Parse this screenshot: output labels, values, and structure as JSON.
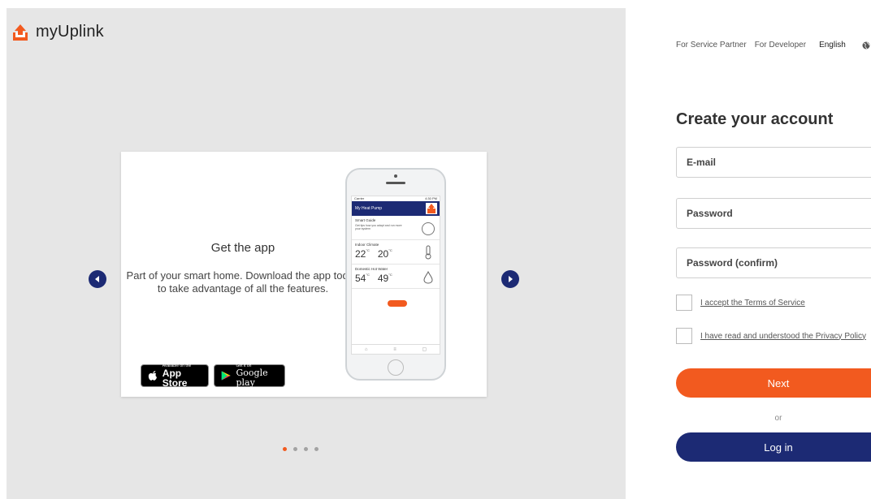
{
  "brand": {
    "name": "myUplink",
    "color": "#f25a1f",
    "navy": "#1c2a74"
  },
  "carousel": {
    "title": "Get the app",
    "body": "Part of your smart home. Download the app today to take advantage of all the features.",
    "app_store": {
      "small": "Available on the",
      "big": "App Store"
    },
    "google_play": {
      "small": "Get it on",
      "big": "Google play"
    },
    "dots": 4,
    "active_dot": 0,
    "phone": {
      "carrier": "Carrier",
      "time": "4:30 PM",
      "app_title": "My Heat Pump",
      "smart_guide": "Smart Guide",
      "smart_guide_desc": "Get tips how you adapt and run more your system",
      "indoor_climate": "Indoor Climate",
      "indoor_temp1": "22",
      "indoor_temp2": "20",
      "hot_water": "Domestic Hot Water",
      "hot_temp1": "54",
      "hot_temp2": "49",
      "unit": "°C"
    }
  },
  "top_nav": {
    "service_partner": "For Service Partner",
    "developer": "For Developer",
    "language": "English"
  },
  "form": {
    "title": "Create your account",
    "email_placeholder": "E-mail",
    "password_placeholder": "Password",
    "password_confirm_placeholder": "Password (confirm)",
    "terms_label": "I accept the Terms of Service",
    "privacy_label": "I have read and understood the Privacy Policy",
    "next_label": "Next",
    "or_label": "or",
    "login_label": "Log in"
  }
}
